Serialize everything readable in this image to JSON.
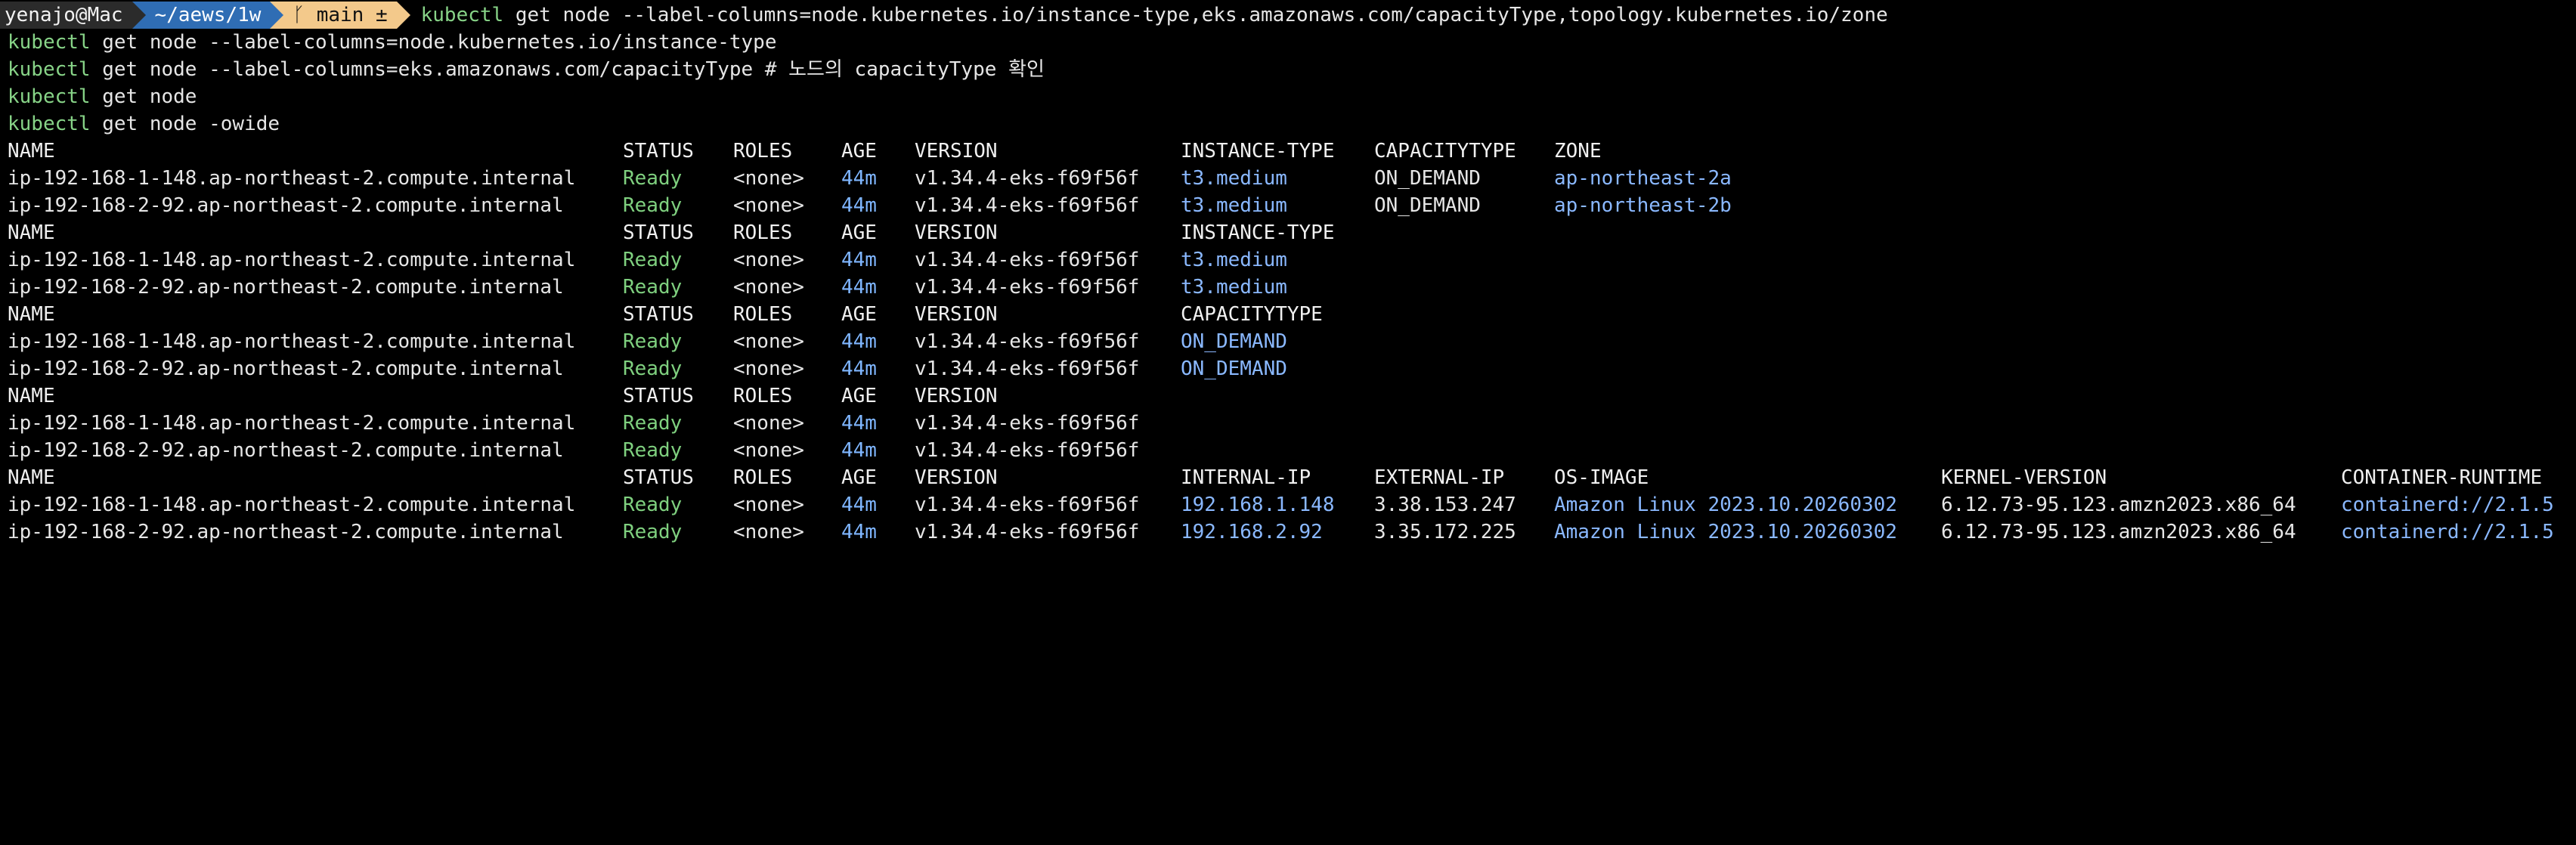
{
  "prompt": {
    "user": "yenajo@Mac",
    "dir": "~/aews/1w",
    "git": "ᚴ main ±",
    "command": "get node --label-columns=node.kubernetes.io/instance-type,eks.amazonaws.com/capacityType,topology.kubernetes.io/zone"
  },
  "commands": [
    {
      "kw": "kubectl",
      "rest": " get node --label-columns=node.kubernetes.io/instance-type",
      "comment": ""
    },
    {
      "kw": "kubectl",
      "rest": " get node --label-columns=eks.amazonaws.com/capacityType ",
      "comment": "# 노드의 capacityType 확인"
    },
    {
      "kw": "kubectl",
      "rest": " get node",
      "comment": ""
    },
    {
      "kw": "kubectl",
      "rest": " get node -owide",
      "comment": ""
    }
  ],
  "first_kw": "kubectl",
  "headers": {
    "name": "NAME",
    "status": "STATUS",
    "roles": "ROLES",
    "age": "AGE",
    "version": "VERSION",
    "instance_type": "INSTANCE-TYPE",
    "capacitytype": "CAPACITYTYPE",
    "zone": "ZONE",
    "internal_ip": "INTERNAL-IP",
    "external_ip": "EXTERNAL-IP",
    "os_image": "OS-IMAGE",
    "kernel": "KERNEL-VERSION",
    "runtime": "CONTAINER-RUNTIME"
  },
  "nodes": [
    {
      "name": "ip-192-168-1-148.ap-northeast-2.compute.internal",
      "status": "Ready",
      "roles": "<none>",
      "age": "44m",
      "version": "v1.34.4-eks-f69f56f",
      "instance_type": "t3.medium",
      "capacitytype": "ON_DEMAND",
      "zone": "ap-northeast-2a",
      "internal_ip": "192.168.1.148",
      "external_ip": "3.38.153.247",
      "os_image": "Amazon Linux 2023.10.20260302",
      "kernel": "6.12.73-95.123.amzn2023.x86_64",
      "runtime": "containerd://2.1.5"
    },
    {
      "name": "ip-192-168-2-92.ap-northeast-2.compute.internal",
      "status": "Ready",
      "roles": "<none>",
      "age": "44m",
      "version": "v1.34.4-eks-f69f56f",
      "instance_type": "t3.medium",
      "capacitytype": "ON_DEMAND",
      "zone": "ap-northeast-2b",
      "internal_ip": "192.168.2.92",
      "external_ip": "3.35.172.225",
      "os_image": "Amazon Linux 2023.10.20260302",
      "kernel": "6.12.73-95.123.amzn2023.x86_64",
      "runtime": "containerd://2.1.5"
    }
  ]
}
